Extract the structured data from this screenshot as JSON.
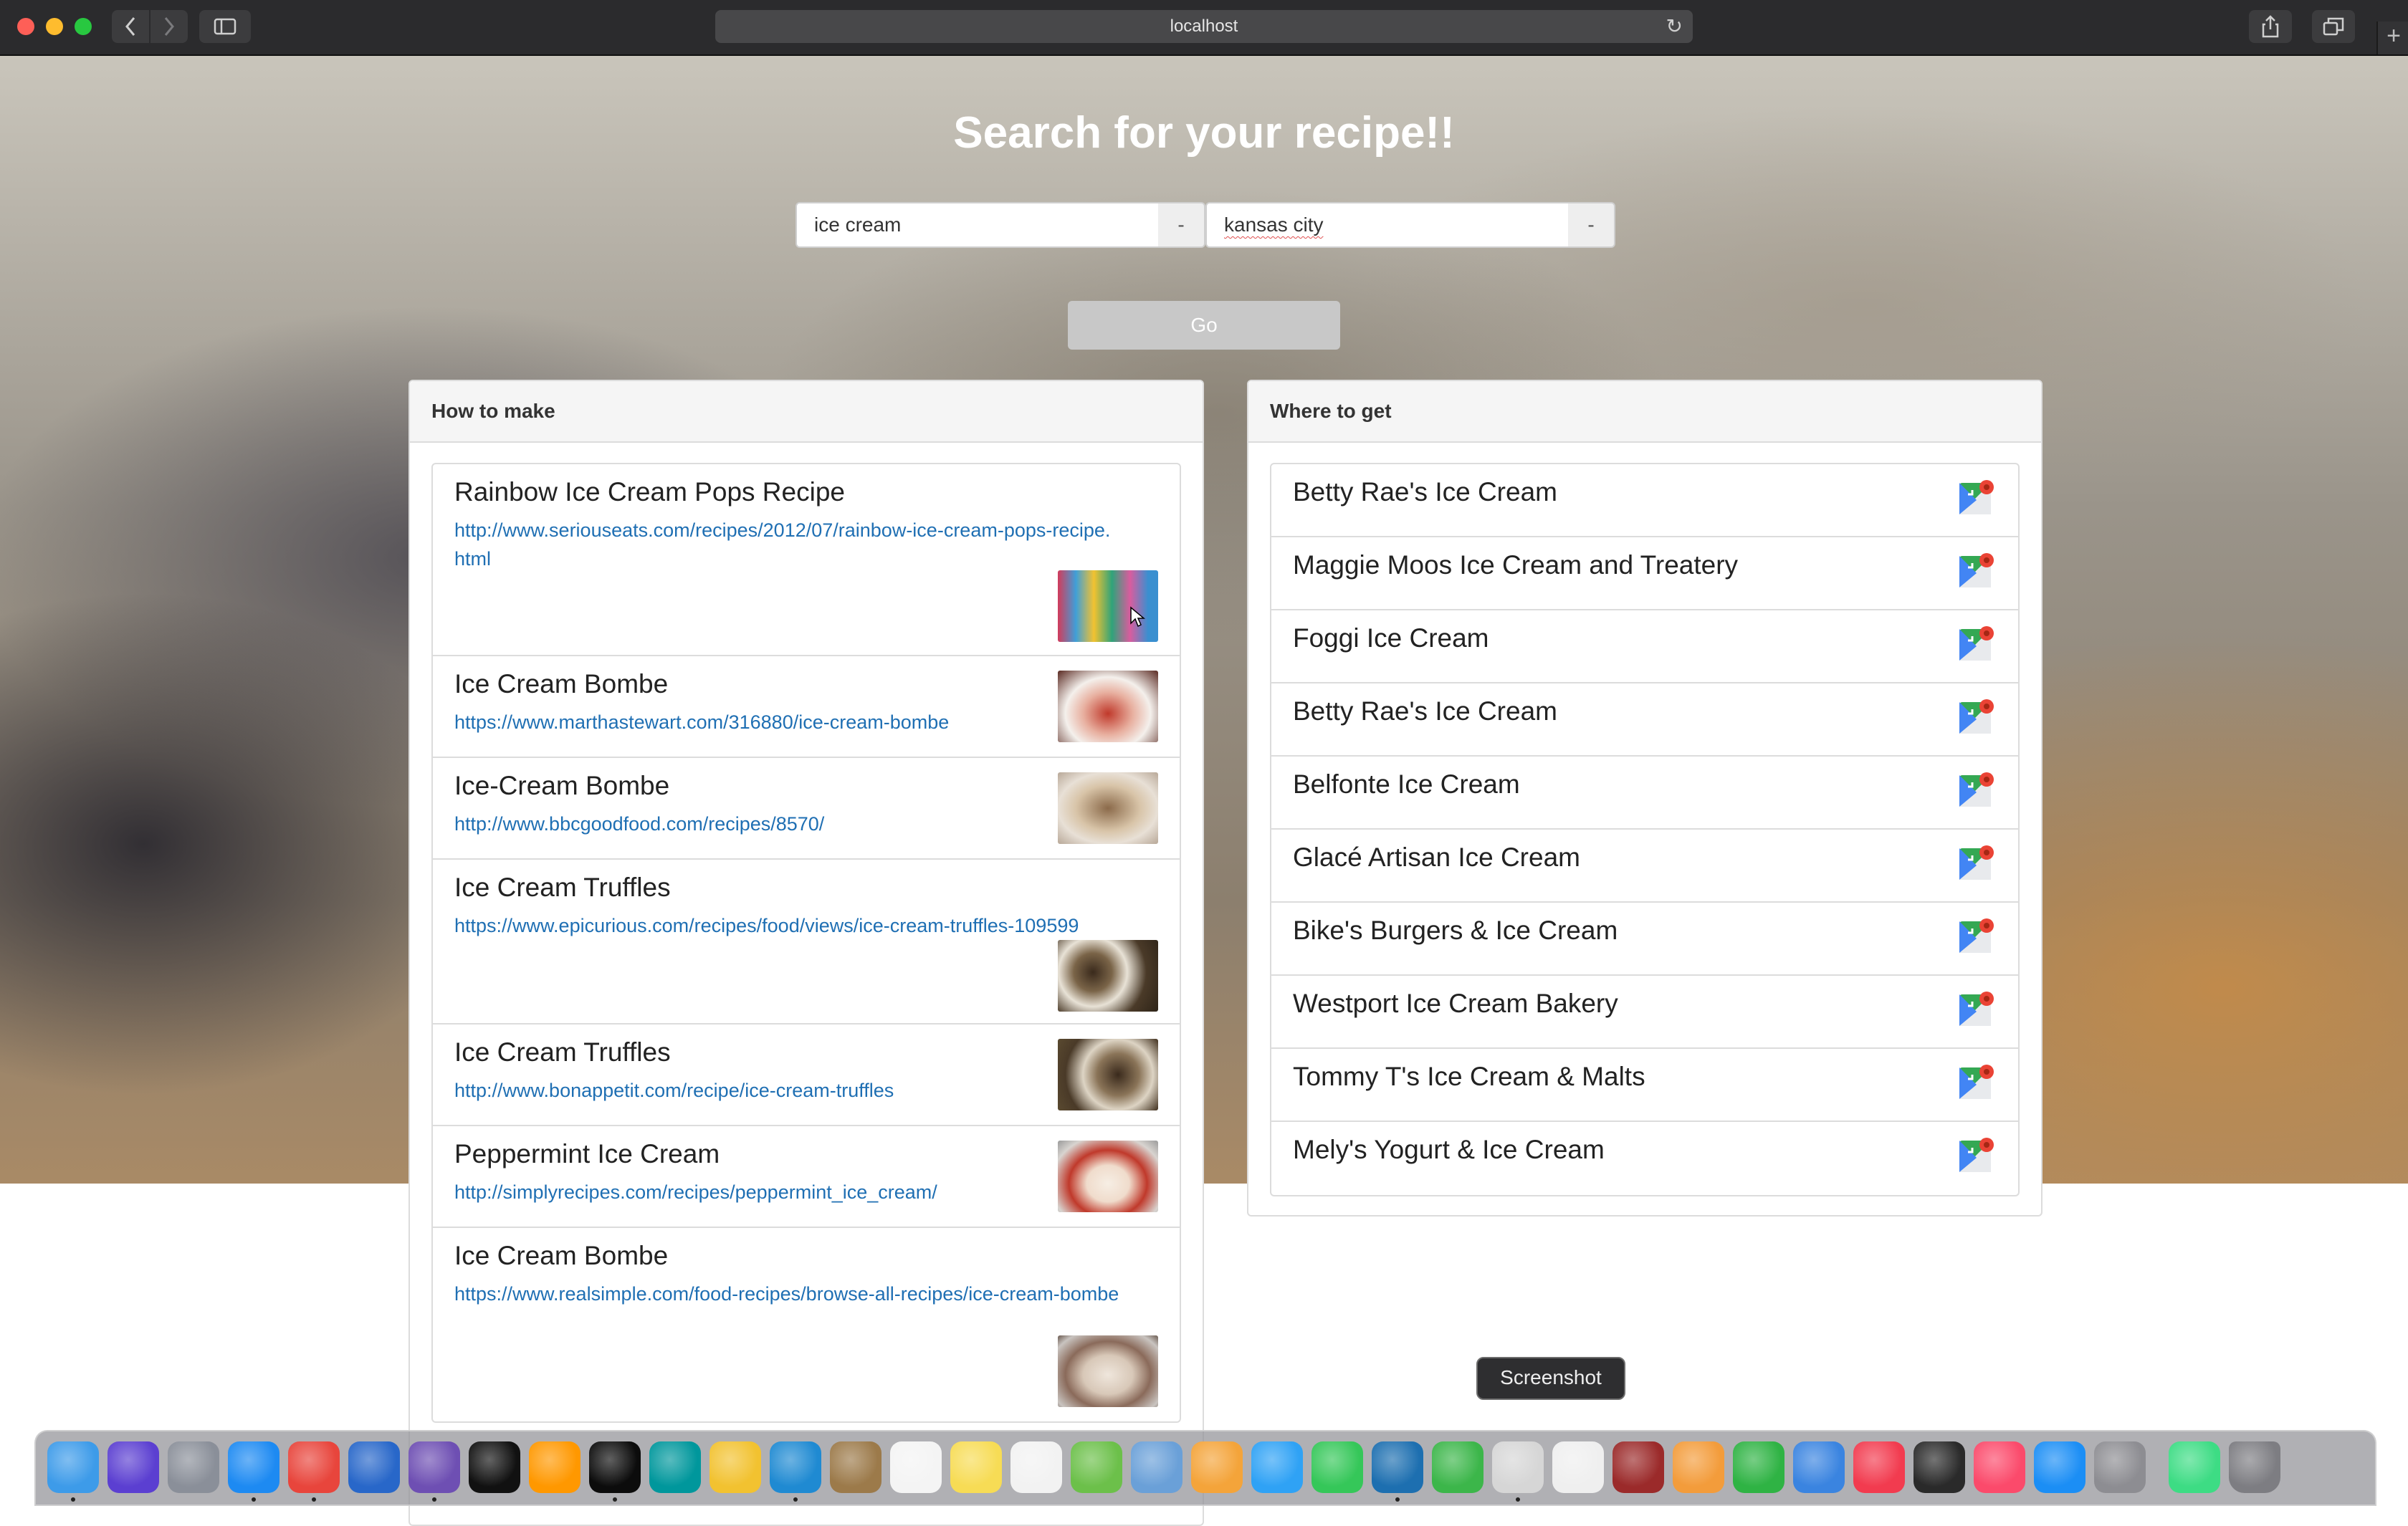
{
  "browser": {
    "url": "localhost"
  },
  "page": {
    "title": "Search for your recipe!!",
    "search": {
      "recipe_value": "ice cream",
      "recipe_addon": "-",
      "location_value": "kansas city",
      "location_addon": "-",
      "go_label": "Go"
    }
  },
  "recipes_panel": {
    "heading": "How to make",
    "items": [
      {
        "title": "Rainbow Ice Cream Pops Recipe",
        "url": "http://www.seriouseats.com/recipes/2012/07/rainbow-ice-cream-pops-recipe.html"
      },
      {
        "title": "Ice Cream Bombe",
        "url": "https://www.marthastewart.com/316880/ice-cream-bombe"
      },
      {
        "title": "Ice-Cream Bombe",
        "url": "http://www.bbcgoodfood.com/recipes/8570/"
      },
      {
        "title": "Ice Cream Truffles",
        "url": "https://www.epicurious.com/recipes/food/views/ice-cream-truffles-109599"
      },
      {
        "title": "Ice Cream Truffles",
        "url": "http://www.bonappetit.com/recipe/ice-cream-truffles"
      },
      {
        "title": "Peppermint Ice Cream",
        "url": "http://simplyrecipes.com/recipes/peppermint_ice_cream/"
      },
      {
        "title": "Ice Cream Bombe",
        "url": "https://www.realsimple.com/food-recipes/browse-all-recipes/ice-cream-bombe"
      }
    ]
  },
  "places_panel": {
    "heading": "Where to get",
    "items": [
      {
        "name": "Betty Rae's Ice Cream"
      },
      {
        "name": "Maggie Moos Ice Cream and Treatery"
      },
      {
        "name": "Foggi Ice Cream"
      },
      {
        "name": "Betty Rae's Ice Cream"
      },
      {
        "name": "Belfonte Ice Cream"
      },
      {
        "name": "Glacé Artisan Ice Cream"
      },
      {
        "name": "Bike's Burgers & Ice Cream"
      },
      {
        "name": "Westport Ice Cream Bakery"
      },
      {
        "name": "Tommy T's Ice Cream & Malts"
      },
      {
        "name": "Mely's Yogurt & Ice Cream"
      }
    ]
  },
  "dock": {
    "tooltip": "Screenshot"
  },
  "colors": {
    "link": "#1f6fb3",
    "go_button": "#c8c8c8"
  }
}
